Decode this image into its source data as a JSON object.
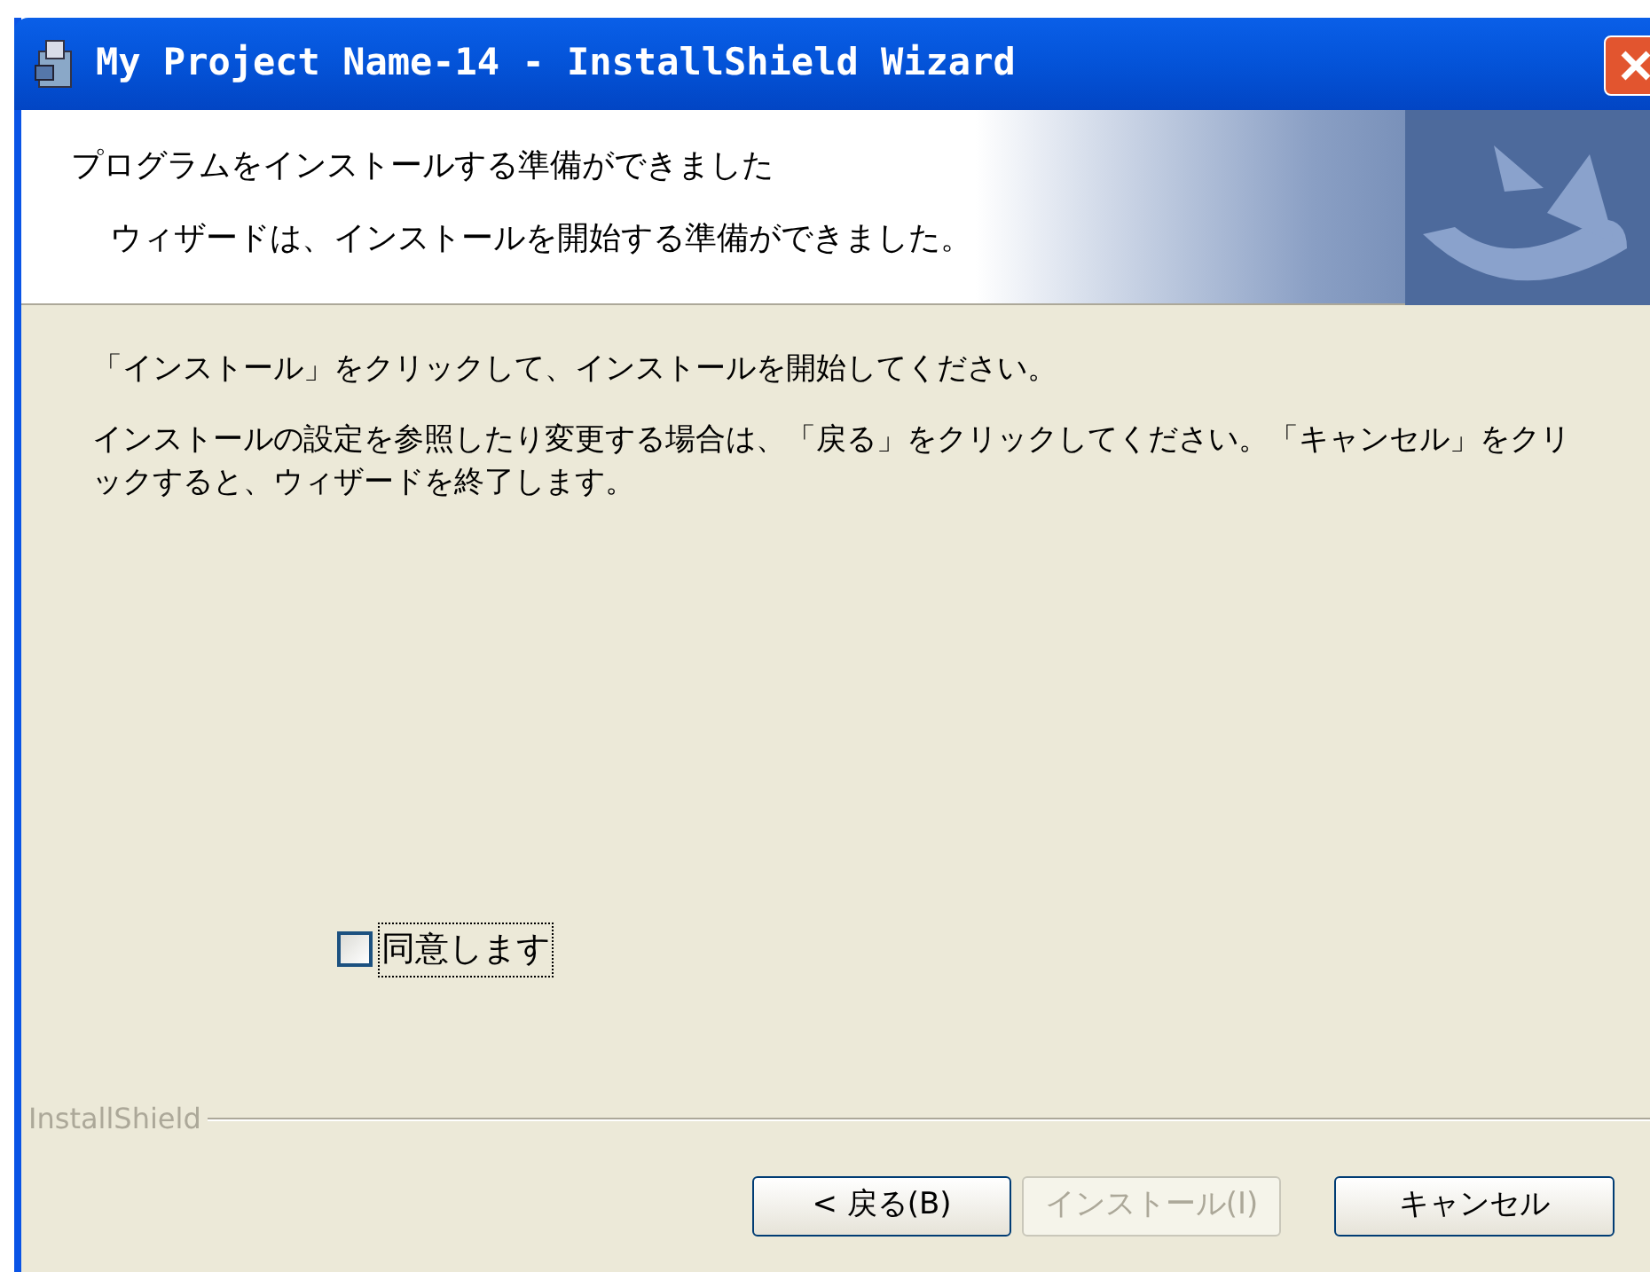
{
  "window": {
    "title": "My Project Name-14 - InstallShield Wizard"
  },
  "header": {
    "title": "プログラムをインストールする準備ができました",
    "subtitle": "ウィザードは、インストールを開始する準備ができました。"
  },
  "body": {
    "paragraphs": [
      "「インストール」をクリックして、インストールを開始してください。",
      "インストールの設定を参照したり変更する場合は、「戻る」をクリックしてください。「キャンセル」をクリックすると、ウィザードを終了します。"
    ]
  },
  "agree": {
    "label": "同意します",
    "checked": false
  },
  "brand": "InstallShield",
  "buttons": [
    {
      "label": "< 戻る(B)",
      "disabled": false
    },
    {
      "label": "インストール(I)",
      "disabled": true
    },
    {
      "label": "キャンセル",
      "disabled": false
    }
  ]
}
